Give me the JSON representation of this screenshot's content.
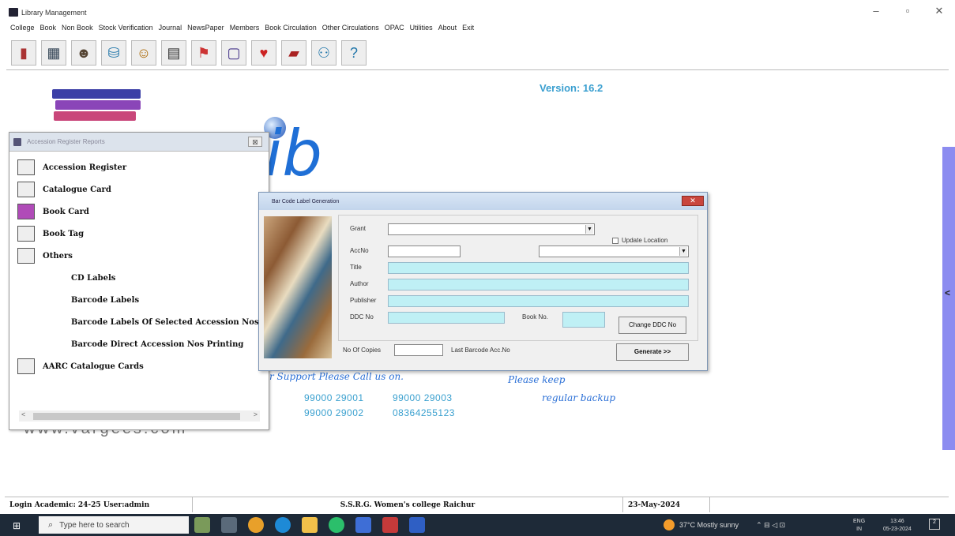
{
  "window": {
    "title": "Library Management",
    "minimize": "–",
    "maximize": "▫",
    "close": "✕"
  },
  "menu": [
    "College",
    "Book",
    "Non Book",
    "Stock Verification",
    "Journal",
    "NewsPaper",
    "Members",
    "Book Circulation",
    "Other Circulations",
    "OPAC",
    "Utilities",
    "About",
    "Exit"
  ],
  "toolbar_icons": [
    "books-icon",
    "catalogue-icon",
    "member-icon",
    "network-icon",
    "person-icon",
    "card-icon",
    "flag-icon",
    "frame-icon",
    "heart-icon",
    "book-red-icon",
    "users-icon",
    "help-icon"
  ],
  "main": {
    "version": "Version: 16.2",
    "logo_text": "ib",
    "support_text": "r Support Please Call us on.",
    "phone1": "99000 29001",
    "phone2": "99000 29003",
    "phone3": "99000 29002",
    "phone4": "08364255123",
    "keep": "Please keep",
    "backup": "regular backup",
    "faded_url": "www.vargees.com",
    "right_arrow": "<"
  },
  "accession": {
    "title": "Accession Register Reports",
    "close": "⊠",
    "items": [
      {
        "label": "Accession Register"
      },
      {
        "label": "Catalogue Card"
      },
      {
        "label": "Book Card"
      },
      {
        "label": "Book Tag"
      },
      {
        "label": "Others"
      },
      {
        "label": "CD Labels"
      },
      {
        "label": "Barcode Labels"
      },
      {
        "label": "Barcode Labels Of Selected Accession Nos"
      },
      {
        "label": "Barcode Direct Accession Nos Printing"
      },
      {
        "label": "AARC Catalogue Cards"
      }
    ],
    "scroll_left": "<",
    "scroll_right": ">"
  },
  "barcode": {
    "title": "Bar Code Label Generation",
    "grant_label": "Grant",
    "accno_label": "AccNo",
    "title_label": "Title",
    "author_label": "Author",
    "publisher_label": "Publisher",
    "ddc_label": "DDC No",
    "bookno_label": "Book No.",
    "update_location": "Update Location",
    "change_ddc": "Change DDC No",
    "copies_label": "No Of Copies",
    "last_barcode": "Last Barcode Acc.No",
    "generate": "Generate >>"
  },
  "status": {
    "login": "Login Academic: 24-25 User:admin",
    "college": "S.S.R.G. Women's college Raichur",
    "date": "23-May-2024"
  },
  "taskbar": {
    "search_placeholder": "Type here to search",
    "weather": "37°C  Mostly sunny",
    "lang1": "ENG",
    "lang2": "IN",
    "time": "13:46",
    "date": "05-23-2024",
    "notif": "2"
  },
  "colors": {
    "accent": "#3a9fd0",
    "cyan_field": "#bff0f5",
    "sidebar": "#8c8cf0"
  }
}
